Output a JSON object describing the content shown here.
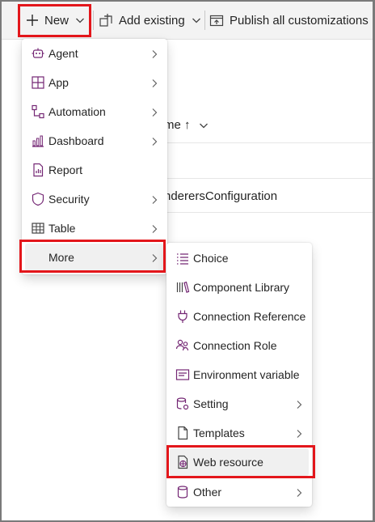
{
  "toolbar": {
    "new_label": "New",
    "add_existing_label": "Add existing",
    "publish_label": "Publish all customizations"
  },
  "background": {
    "column_header": "me ↑",
    "row_text": "nderersConfiguration"
  },
  "new_menu": {
    "items": [
      {
        "label": "Agent",
        "icon": "bot-icon",
        "submenu": true
      },
      {
        "label": "App",
        "icon": "app-grid-icon",
        "submenu": true
      },
      {
        "label": "Automation",
        "icon": "flow-icon",
        "submenu": true
      },
      {
        "label": "Dashboard",
        "icon": "chart-icon",
        "submenu": true
      },
      {
        "label": "Report",
        "icon": "report-icon",
        "submenu": false
      },
      {
        "label": "Security",
        "icon": "shield-icon",
        "submenu": true
      },
      {
        "label": "Table",
        "icon": "table-icon",
        "submenu": true
      },
      {
        "label": "More",
        "icon": "",
        "submenu": true
      }
    ]
  },
  "more_menu": {
    "items": [
      {
        "label": "Choice",
        "icon": "list-icon",
        "submenu": false
      },
      {
        "label": "Component Library",
        "icon": "library-icon",
        "submenu": false
      },
      {
        "label": "Connection Reference",
        "icon": "plug-icon",
        "submenu": false
      },
      {
        "label": "Connection Role",
        "icon": "people-icon",
        "submenu": false
      },
      {
        "label": "Environment variable",
        "icon": "variable-icon",
        "submenu": false
      },
      {
        "label": "Setting",
        "icon": "database-gear-icon",
        "submenu": true
      },
      {
        "label": "Templates",
        "icon": "document-icon",
        "submenu": true
      },
      {
        "label": "Web resource",
        "icon": "web-document-icon",
        "submenu": false
      },
      {
        "label": "Other",
        "icon": "database-icon",
        "submenu": true
      }
    ]
  },
  "colors": {
    "icon_accent": "#742774",
    "highlight": "#e3161b",
    "hover_bg": "#f0f0f0"
  }
}
